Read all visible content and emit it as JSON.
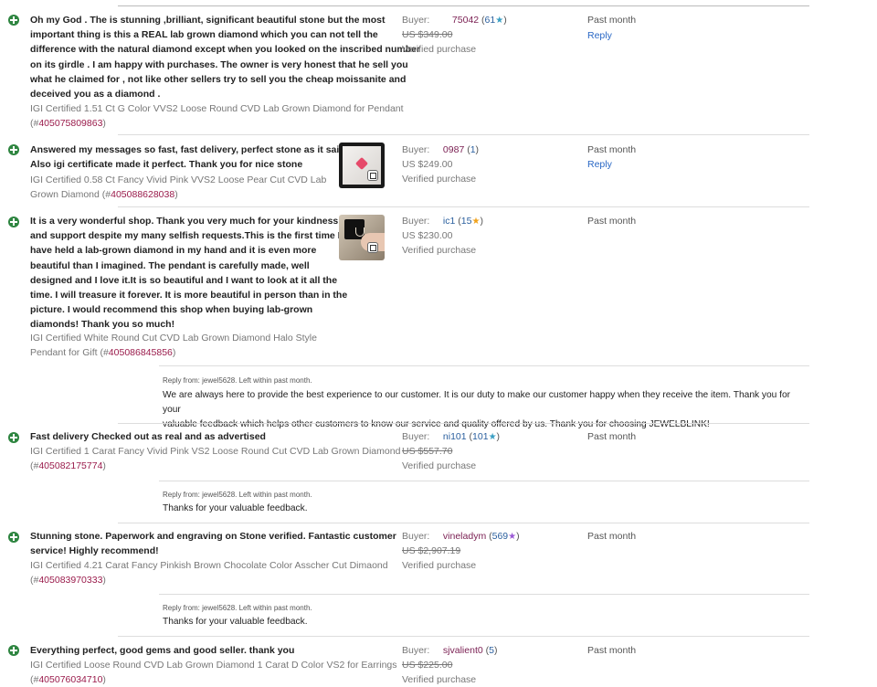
{
  "entries": [
    {
      "comment": [
        "Oh my God . The is stunning ,brilliant, significant beautiful stone but the most",
        "important thing is this a REAL lab grown diamond which you can not tell the",
        "difference with the natural diamond except when you looked on the inscribed number",
        "on its girdle . I am happy with purchases. The owner is very honest that he sell you",
        "what he claimed for , not like other sellers try to sell you the cheap moissanite and",
        "deceived you as a diamond ."
      ],
      "item_lines": [
        "IGI Certified 1.51 Ct G Color VVS2 Loose Round CVD Lab Grown Diamond for Pendant"
      ],
      "item_prefix": "(#",
      "item_number": "405075809863",
      "item_suffix": ")",
      "buyer_label": "Buyer:",
      "buyer_name": "75042",
      "buyer_score": "61",
      "price": "US $349.00",
      "verified": "Verified purchase",
      "when": "Past month",
      "reply_link": "Reply"
    },
    {
      "comment": [
        "Answered my messages so fast, fast delivery, perfect stone as it said!!",
        "Also igi certificate made it perfect. Thank you for nice stone"
      ],
      "item_lines": [
        "IGI Certified 0.58 Ct Fancy Vivid Pink VVS2 Loose Pear Cut CVD Lab"
      ],
      "item_prefix": "Grown Diamond (#",
      "item_number": "405088628038",
      "item_suffix": ")",
      "buyer_label": "Buyer:",
      "buyer_name": "0987",
      "buyer_score": "1",
      "price": "US $249.00",
      "verified": "Verified purchase",
      "when": "Past month",
      "reply_link": "Reply"
    },
    {
      "comment": [
        "It is a very wonderful shop. Thank you very much for your kindness",
        "and support despite my many selfish requests.This is the first time I",
        "have held a lab-grown diamond in my hand and it is even more",
        "beautiful than I imagined. The pendant is carefully made, well",
        "designed and I love it.It is so beautiful and I want to look at it all the",
        "time. I will treasure it forever. It is more beautiful in person than in the",
        "picture. I would recommend this shop when buying lab-grown",
        "diamonds! Thank you so much!"
      ],
      "item_lines": [
        "IGI Certified White Round Cut CVD Lab Grown Diamond Halo Style"
      ],
      "item_prefix": "Pendant for Gift (#",
      "item_number": "405086845856",
      "item_suffix": ")",
      "buyer_label": "Buyer:",
      "buyer_name": "ic1",
      "buyer_score": "15",
      "price": "US $230.00",
      "verified": "Verified purchase",
      "when": "Past month",
      "reply_meta": "Reply from: jewel5628. Left within past month.",
      "reply_body": [
        "We are always here to provide the best experience to our customer. It is our duty to make our customer happy when they receive the item. Thank you for your",
        "valuable feedback which helps other customers to know our service and quality offered by us. Thank you for choosing JEWELBLINK!"
      ]
    },
    {
      "comment": [
        "Fast delivery Checked out as real and as advertised"
      ],
      "item_lines": [
        "IGI Certified 1 Carat Fancy Vivid Pink VS2 Loose Round Cut CVD Lab Grown Diamond"
      ],
      "item_prefix": "(#",
      "item_number": "405082175774",
      "item_suffix": ")",
      "buyer_label": "Buyer:",
      "buyer_name": "ni101",
      "buyer_score": "101",
      "price": "US $557.70",
      "verified": "Verified purchase",
      "when": "Past month",
      "reply_meta": "Reply from: jewel5628. Left within past month.",
      "reply_body": [
        "Thanks for your valuable feedback."
      ]
    },
    {
      "comment": [
        "Stunning stone. Paperwork and engraving on Stone verified. Fantastic customer",
        "service! Highly recommend!"
      ],
      "item_lines": [
        "IGI Certified 4.21 Carat Fancy Pinkish Brown Chocolate Color Asscher Cut Dimaond"
      ],
      "item_prefix": "(#",
      "item_number": "405083970333",
      "item_suffix": ")",
      "buyer_label": "Buyer:",
      "buyer_name": "vineladym",
      "buyer_score": "569",
      "price": "US $2,907.19",
      "verified": "Verified purchase",
      "when": "Past month",
      "reply_meta": "Reply from: jewel5628. Left within past month.",
      "reply_body": [
        "Thanks for your valuable feedback."
      ]
    },
    {
      "comment": [
        "Everything perfect, good gems and good seller. thank you"
      ],
      "item_lines": [
        "IGI Certified Loose Round CVD Lab Grown Diamond 1 Carat D Color VS2 for Earrings"
      ],
      "item_prefix": "(#",
      "item_number": "405076034710",
      "item_suffix": ")",
      "buyer_label": "Buyer:",
      "buyer_name": "sjvalient0",
      "buyer_score": "5",
      "price": "US $225.00",
      "verified": "Verified purchase",
      "when": "Past month"
    }
  ],
  "icons": {
    "positive": "plus-circle-icon",
    "star": "star-icon",
    "gallery": "image-gallery-icon"
  },
  "colors": {
    "positive": "#2e8540",
    "link": "#2a68c5",
    "item_link": "#9a1b4b",
    "star_teal": "#3a9fc4",
    "star_orange": "#f0a11a",
    "star_purple": "#9b59d6"
  }
}
